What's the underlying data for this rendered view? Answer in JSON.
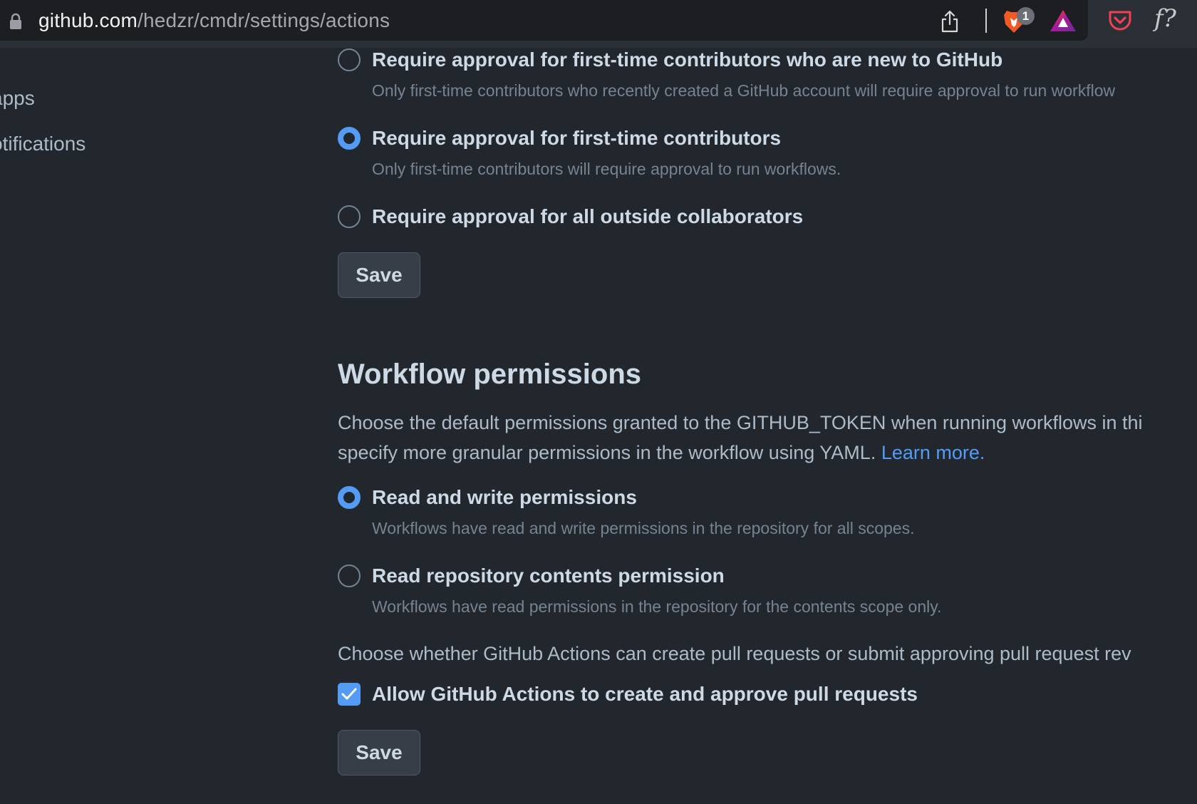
{
  "browser": {
    "url_host": "github.com",
    "url_path": "/hedzr/cmdr/settings/actions",
    "brave_shields_count": "1",
    "extension_label": "f?",
    "icons": [
      "lock-icon",
      "share-icon",
      "brave-shield-icon",
      "bat-rewards-icon",
      "pocket-icon",
      "extension-icon"
    ]
  },
  "sidebar": {
    "items": [
      {
        "label": "apps"
      },
      {
        "label": "otifications"
      }
    ]
  },
  "approval": {
    "options": [
      {
        "label": "Require approval for first-time contributors who are new to GitHub",
        "description": "Only first-time contributors who recently created a GitHub account will require approval to run workflow",
        "checked": false
      },
      {
        "label": "Require approval for first-time contributors",
        "description": "Only first-time contributors will require approval to run workflows.",
        "checked": true
      },
      {
        "label": "Require approval for all outside collaborators",
        "description": "",
        "checked": false
      }
    ],
    "save_label": "Save"
  },
  "workflow_permissions": {
    "title": "Workflow permissions",
    "description_line1": "Choose the default permissions granted to the GITHUB_TOKEN when running workflows in thi",
    "description_line2": "specify more granular permissions in the workflow using YAML.",
    "learn_more": "Learn more.",
    "options": [
      {
        "label": "Read and write permissions",
        "description": "Workflows have read and write permissions in the repository for all scopes.",
        "checked": true
      },
      {
        "label": "Read repository contents permission",
        "description": "Workflows have read permissions in the repository for the contents scope only.",
        "checked": false
      }
    ],
    "pr_description": "Choose whether GitHub Actions can create pull requests or submit approving pull request rev",
    "pr_checkbox_label": "Allow GitHub Actions to create and approve pull requests",
    "pr_checkbox_checked": true,
    "save_label": "Save"
  },
  "colors": {
    "background": "#22272e",
    "accent": "#539bf5",
    "text_primary": "#cdd9e5",
    "text_muted": "#768390"
  }
}
